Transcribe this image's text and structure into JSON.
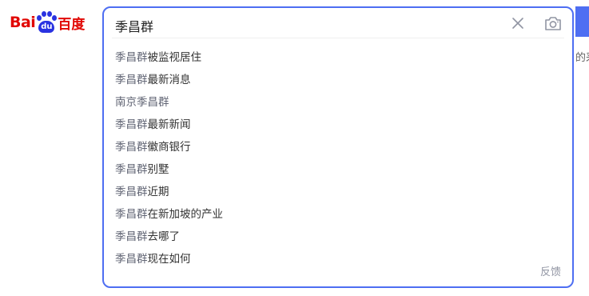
{
  "logo": {
    "word": "Bai",
    "paw_text": "du",
    "cn": "百度"
  },
  "search": {
    "query": "季昌群"
  },
  "suggestions": [
    {
      "highlight": "季昌群",
      "rest": "被监视居住"
    },
    {
      "highlight": "季昌群",
      "rest": "最新消息"
    },
    {
      "highlight": "",
      "rest": "南京季昌群"
    },
    {
      "highlight": "季昌群",
      "rest": "最新新闻"
    },
    {
      "highlight": "季昌群",
      "rest": "徽商银行"
    },
    {
      "highlight": "季昌群",
      "rest": "别墅"
    },
    {
      "highlight": "季昌群",
      "rest": "近期"
    },
    {
      "highlight": "季昌群",
      "rest": "在新加坡的产业"
    },
    {
      "highlight": "季昌群",
      "rest": "去哪了"
    },
    {
      "highlight": "季昌群",
      "rest": "现在如何"
    }
  ],
  "feedback_label": "反馈",
  "background_text": "的采",
  "icons": {
    "clear": "close-icon",
    "camera": "camera-icon"
  },
  "colors": {
    "accent": "#4e6ef2",
    "logo_red": "#e10602",
    "logo_blue": "#2932e1"
  }
}
